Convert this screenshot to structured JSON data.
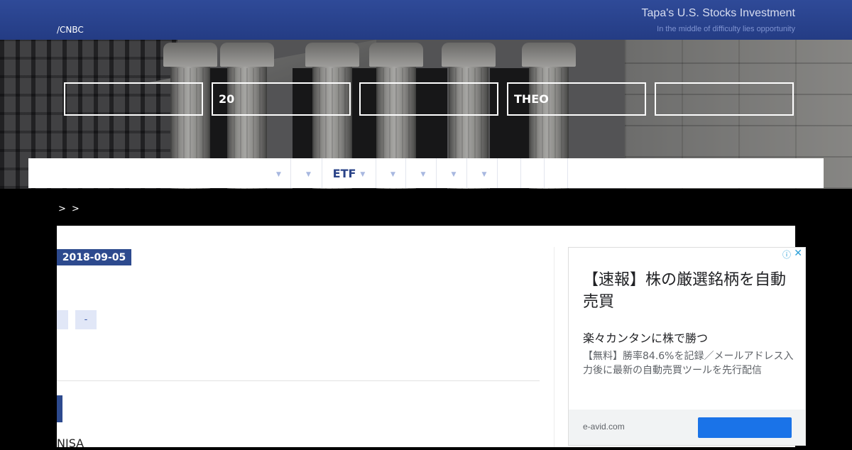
{
  "header": {
    "source": "/CNBC",
    "site_title": "Tapa's U.S. Stocks Investment",
    "tagline": "In the middle of difficulty lies opportunity"
  },
  "hero_boxes": [
    "",
    "20",
    "",
    "THEO",
    ""
  ],
  "nav": {
    "items": [
      {
        "label": "",
        "has_dropdown": true
      },
      {
        "label": "",
        "has_dropdown": true
      },
      {
        "label": "ETF",
        "has_dropdown": true
      },
      {
        "label": "",
        "has_dropdown": true
      },
      {
        "label": "",
        "has_dropdown": true
      },
      {
        "label": "",
        "has_dropdown": true
      },
      {
        "label": "",
        "has_dropdown": true
      },
      {
        "label": "",
        "has_dropdown": false
      },
      {
        "label": "",
        "has_dropdown": false
      },
      {
        "label": "",
        "has_dropdown": false
      }
    ]
  },
  "breadcrumb": {
    "links": [
      "",
      ""
    ],
    "separator": ">"
  },
  "post": {
    "date": "2018-09-05",
    "tags": [
      "",
      "-"
    ],
    "body_snippet": "NISA"
  },
  "ad": {
    "headline": "【速報】株の厳選銘柄を自動売買",
    "subheading": "楽々カンタンに株で勝つ",
    "body": "【無料】勝率84.6%を記録／メールアドレス入力後に最新の自動売買ツールを先行配信",
    "domain": "e-avid.com",
    "info_icon": "ⓘ",
    "close_icon": "✕",
    "button_label": "",
    "button_color": "#1a73e8"
  },
  "colors": {
    "header_bg": "#2a4590",
    "accent": "#2d4a8e",
    "nav_text": "#2a4388",
    "tag_bg": "#e1e7f7"
  }
}
